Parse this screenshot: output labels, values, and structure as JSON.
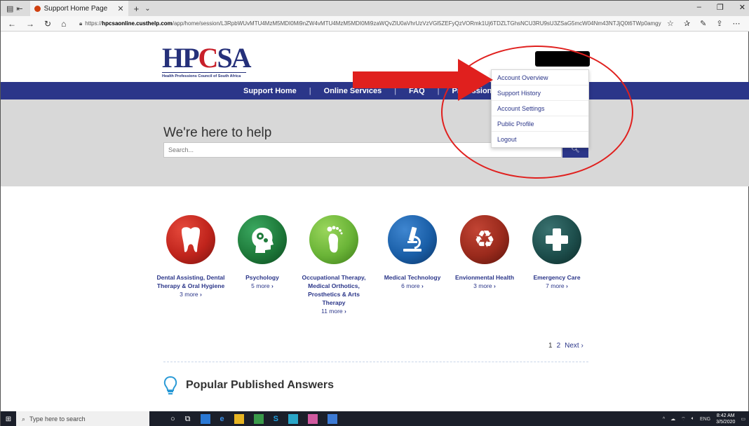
{
  "browser": {
    "tab_title": "Support Home Page",
    "url_prefix": "https://",
    "url_host": "hpcsaonline.custhelp.com",
    "url_path": "/app/home/session/L3RpbWUvMTU4MzM5MDI0Mi9nZW4vMTU4MzM5MDI0Mi9zaWQvZlU0aVhrUzVzVGl5ZEFyQzVORmk1Uj6TDZLTGhsNCU3RU9sU3ZSaG5mcW04Nm43NTJjQ0t6TWp0amgyc1U5OGxoemNCYkxqM2JfUU"
  },
  "site": {
    "logo_text_a": "HP",
    "logo_text_c": "C",
    "logo_text_b": "SA",
    "logo_subtitle": "Health Professions Council of South Africa",
    "nav": [
      "Support Home",
      "Online Services",
      "FAQ",
      "Professional Boards"
    ]
  },
  "hero": {
    "title": "We're here to help",
    "search_placeholder": "Search..."
  },
  "account_menu": {
    "items": [
      "Account Overview",
      "Support History",
      "Account Settings",
      "Public Profile",
      "Logout"
    ]
  },
  "categories": [
    {
      "title": "Dental Assisting, Dental Therapy & Oral Hygiene",
      "more": "3 more",
      "color": "#c0241c",
      "icon": "tooth-icon"
    },
    {
      "title": "Psychology",
      "more": "5 more",
      "color": "#1e7a3a",
      "icon": "head-gears-icon"
    },
    {
      "title": "Occupational Therapy, Medical Orthotics, Prosthetics & Arts Therapy",
      "more": "11 more",
      "color": "#6ab437",
      "icon": "foot-icon"
    },
    {
      "title": "Medical Technology",
      "more": "6 more",
      "color": "#1a5fa8",
      "icon": "microscope-icon"
    },
    {
      "title": "Envionmental Health",
      "more": "3 more",
      "color": "#9a2a1c",
      "icon": "recycle-icon"
    },
    {
      "title": "Emergency Care",
      "more": "7 more",
      "color": "#1d4e4c",
      "icon": "cross-icon"
    }
  ],
  "pager": {
    "current": "1",
    "page2": "2",
    "next": "Next"
  },
  "popular": {
    "title": "Popular Published Answers"
  },
  "taskbar": {
    "search_placeholder": "Type here to search",
    "lang": "ENG",
    "time": "8:42 AM",
    "date": "3/5/2020"
  },
  "colors": {
    "primary": "#2b3689",
    "annotation": "#e0201e"
  }
}
